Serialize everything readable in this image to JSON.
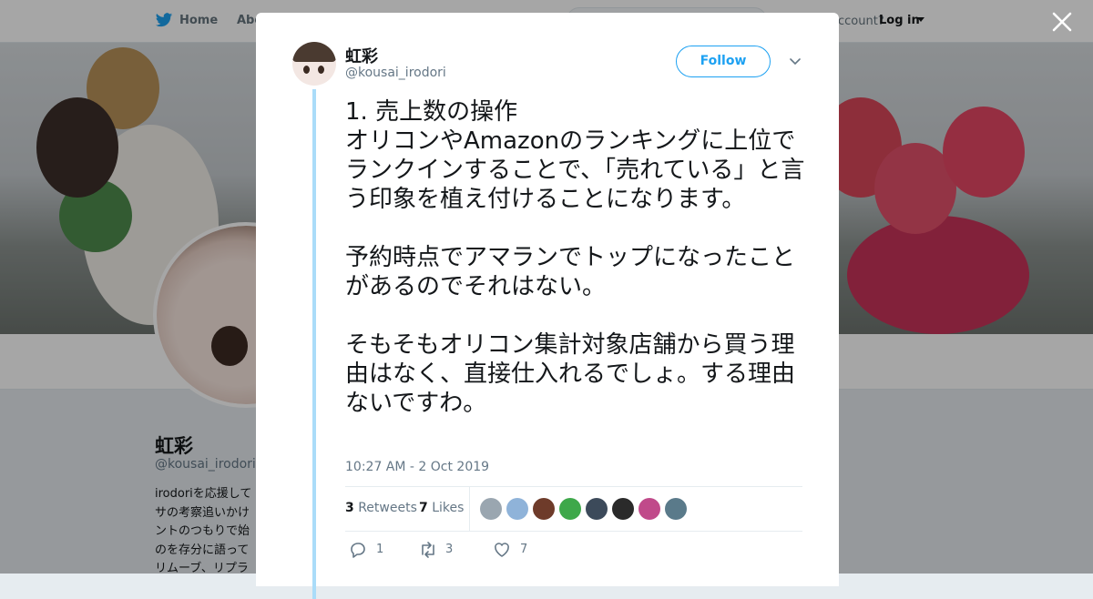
{
  "nav": {
    "home_label": "Home",
    "about_label": "Abo",
    "account_prompt": "ccount?",
    "login_label": "Log in"
  },
  "profile": {
    "name": "虹彩",
    "handle": "@kousai_irodori",
    "bio": "irodoriを応援して\nサの考察追いかけ\nントのつもりで始\nのを存分に語って\nリムーブ、リプラ"
  },
  "tweet": {
    "author_name": "虹彩",
    "author_handle": "@kousai_irodori",
    "follow_label": "Follow",
    "text": "1. 売上数の操作\nオリコンやAmazonのランキングに上位でランクインすることで、「売れている」と言う印象を植え付けることになります。\n\n予約時点でアマランでトップになったことがあるのでそれはない。\n\nそもそもオリコン集計対象店舗から買う理由はなく、直接仕入れるでしょ。する理由ないですわ。",
    "timestamp": "10:27 AM - 2 Oct 2019",
    "retweets_count": "3",
    "retweets_label": "Retweets",
    "likes_count": "7",
    "likes_label": "Likes",
    "reply_count": "1",
    "retweet_action_count": "3",
    "like_action_count": "7"
  },
  "colors": {
    "accent": "#1da1f2",
    "thread_line": "#aadcf9",
    "liker_avatars": [
      "#9aa6b0",
      "#8fb3d9",
      "#6e3b2a",
      "#3ea84a",
      "#3c4a5a",
      "#2a2a2a",
      "#c04a8a",
      "#5a7a8a"
    ]
  }
}
